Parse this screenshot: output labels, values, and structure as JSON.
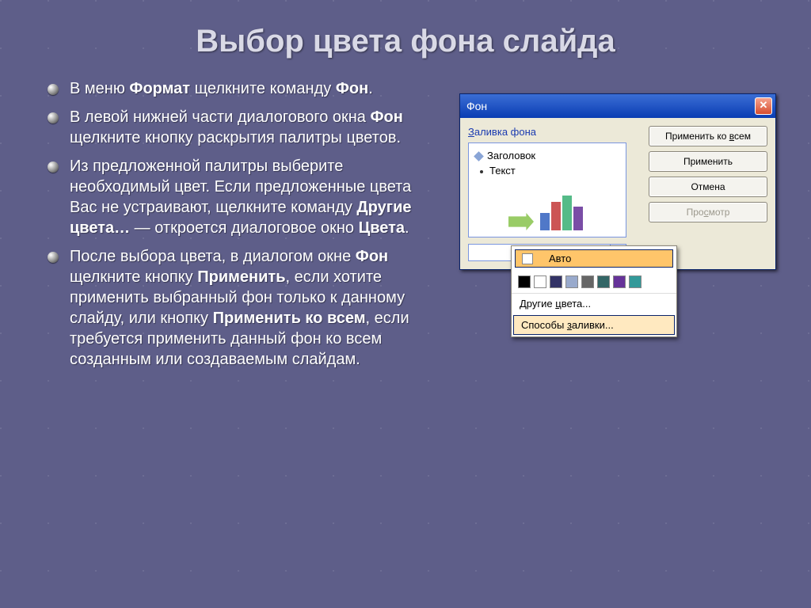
{
  "title": "Выбор цвета фона слайда",
  "bullets": [
    {
      "html": "В меню <b>Формат</b> щелкните команду <b>Фон</b>."
    },
    {
      "html": "В левой нижней части диалогового окна <b>Фон</b>  щелкните кнопку раскрытия палитры цветов."
    },
    {
      "html": "Из предложенной палитры выберите необходимый цвет. Если предложенные цвета Вас не устраивают,  щелкните команду <b>Другие цвета…</b> — откроется диалоговое окно <b>Цвета</b>."
    },
    {
      "html": "После выбора цвета, в диалогом окне <b>Фон</b> щелкните кнопку <b>Применить</b>, если хотите применить выбранный фон только к данному слайду, или кнопку <b>Применить ко всем</b>, если требуется применить данный фон ко всем созданным или создаваемым слайдам."
    }
  ],
  "dialog": {
    "title": "Фон",
    "group_pre": "З",
    "group_post": "аливка фона",
    "preview_title": "Заголовок",
    "preview_text": "Текст",
    "buttons": {
      "apply_all_pre": "Применить ко ",
      "apply_all_u": "в",
      "apply_all_post": "сем",
      "apply": "Применить",
      "cancel": "Отмена",
      "preview_pre": "Про",
      "preview_u": "с",
      "preview_post": "мотр"
    }
  },
  "palette": {
    "auto": "Авто",
    "swatches": [
      "#000000",
      "#ffffff",
      "#333366",
      "#99aacc",
      "#666666",
      "#336666",
      "#663399",
      "#339999"
    ],
    "more_pre": "Другие ",
    "more_u": "ц",
    "more_post": "вета...",
    "fill_pre": "Способы ",
    "fill_u": "з",
    "fill_post": "аливки..."
  }
}
